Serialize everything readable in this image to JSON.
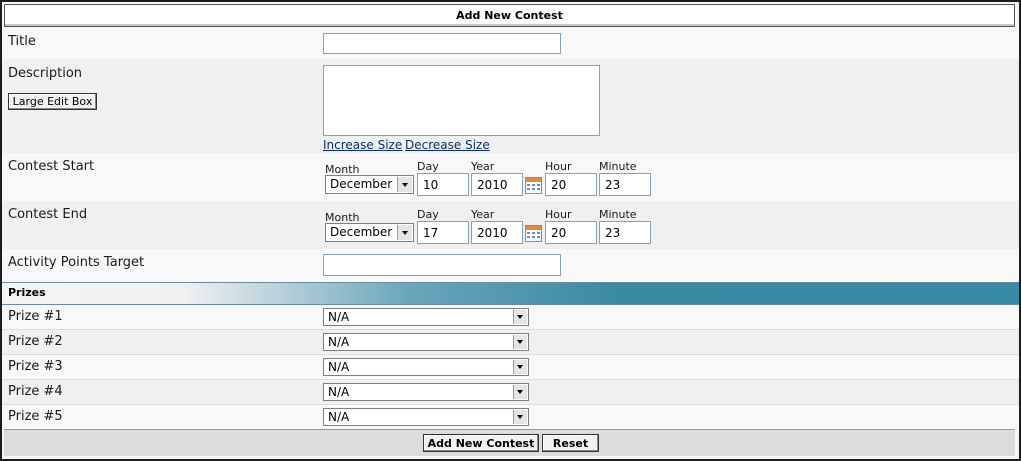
{
  "form": {
    "title": "Add New Contest",
    "title_label": "Title",
    "title_value": "",
    "description_label": "Description",
    "large_edit_button": "Large Edit Box",
    "increase_size": "Increase Size",
    "decrease_size": "Decrease Size",
    "contest_start_label": "Contest Start",
    "contest_end_label": "Contest End",
    "activity_label": "Activity Points Target",
    "activity_value": ""
  },
  "date_labels": {
    "month": "Month",
    "day": "Day",
    "year": "Year",
    "hour": "Hour",
    "minute": "Minute"
  },
  "start": {
    "month": "December",
    "day": "10",
    "year": "2010",
    "hour": "20",
    "minute": "23"
  },
  "end": {
    "month": "December",
    "day": "17",
    "year": "2010",
    "hour": "20",
    "minute": "23"
  },
  "prizes": {
    "header": "Prizes",
    "items": [
      {
        "label": "Prize #1",
        "value": "N/A"
      },
      {
        "label": "Prize #2",
        "value": "N/A"
      },
      {
        "label": "Prize #3",
        "value": "N/A"
      },
      {
        "label": "Prize #4",
        "value": "N/A"
      },
      {
        "label": "Prize #5",
        "value": "N/A"
      }
    ]
  },
  "buttons": {
    "submit": "Add New Contest",
    "reset": "Reset"
  },
  "icons": {
    "calendar": "calendar-icon",
    "dropdown": "chevron-down-icon"
  }
}
